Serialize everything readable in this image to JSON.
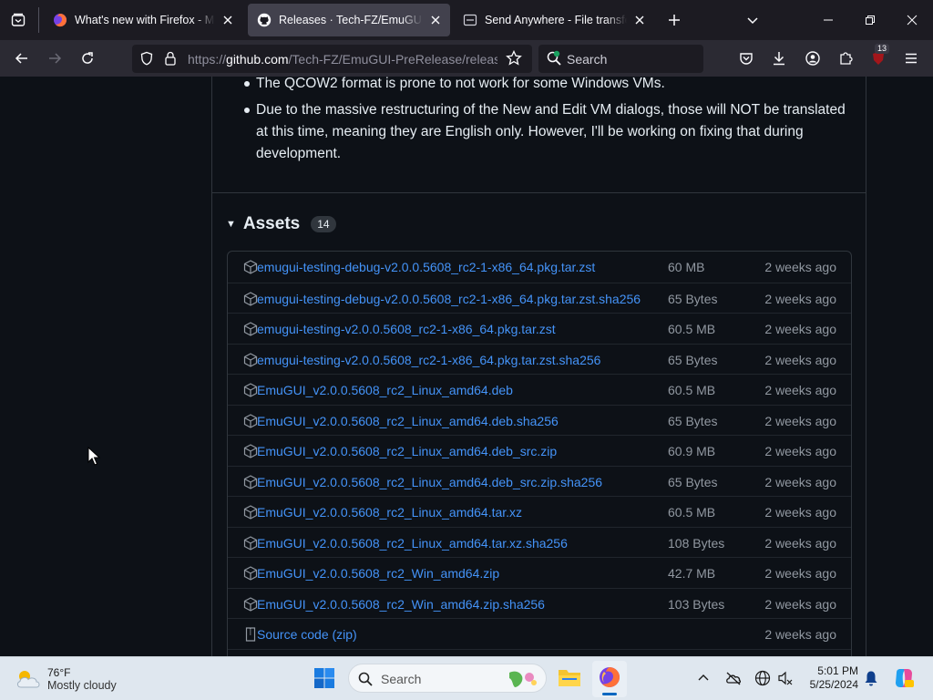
{
  "browser": {
    "tabs": [
      {
        "title": "What's new with Firefox - More",
        "icon": "firefox-icon",
        "active": false
      },
      {
        "title": "Releases · Tech-FZ/EmuGUI-PreRelease",
        "icon": "github-icon",
        "active": true
      },
      {
        "title": "Send Anywhere - File transfer",
        "icon": "send-anywhere-icon",
        "active": false
      }
    ],
    "url": {
      "scheme": "https://",
      "host": "github.com",
      "path": "/Tech-FZ/EmuGUI-PreRelease/releases"
    },
    "search_placeholder": "Search",
    "extension_badge": "13"
  },
  "release": {
    "notes": [
      "The QCOW2 format is prone to not work for some Windows VMs.",
      "Due to the massive restructuring of the New and Edit VM dialogs, those will NOT be translated at this time, meaning they are English only. However, I'll be working on fixing that during development."
    ],
    "assets_title": "Assets",
    "assets_count": "14",
    "assets": [
      {
        "name": "emugui-testing-debug-v2.0.0.5608_rc2-1-x86_64.pkg.tar.zst",
        "size": "60 MB",
        "date": "2 weeks ago"
      },
      {
        "name": "emugui-testing-debug-v2.0.0.5608_rc2-1-x86_64.pkg.tar.zst.sha256",
        "size": "65 Bytes",
        "date": "2 weeks ago"
      },
      {
        "name": "emugui-testing-v2.0.0.5608_rc2-1-x86_64.pkg.tar.zst",
        "size": "60.5 MB",
        "date": "2 weeks ago"
      },
      {
        "name": "emugui-testing-v2.0.0.5608_rc2-1-x86_64.pkg.tar.zst.sha256",
        "size": "65 Bytes",
        "date": "2 weeks ago"
      },
      {
        "name": "EmuGUI_v2.0.0.5608_rc2_Linux_amd64.deb",
        "size": "60.5 MB",
        "date": "2 weeks ago"
      },
      {
        "name": "EmuGUI_v2.0.0.5608_rc2_Linux_amd64.deb.sha256",
        "size": "65 Bytes",
        "date": "2 weeks ago"
      },
      {
        "name": "EmuGUI_v2.0.0.5608_rc2_Linux_amd64.deb_src.zip",
        "size": "60.9 MB",
        "date": "2 weeks ago"
      },
      {
        "name": "EmuGUI_v2.0.0.5608_rc2_Linux_amd64.deb_src.zip.sha256",
        "size": "65 Bytes",
        "date": "2 weeks ago"
      },
      {
        "name": "EmuGUI_v2.0.0.5608_rc2_Linux_amd64.tar.xz",
        "size": "60.5 MB",
        "date": "2 weeks ago"
      },
      {
        "name": "EmuGUI_v2.0.0.5608_rc2_Linux_amd64.tar.xz.sha256",
        "size": "108 Bytes",
        "date": "2 weeks ago"
      },
      {
        "name": "EmuGUI_v2.0.0.5608_rc2_Win_amd64.zip",
        "size": "42.7 MB",
        "date": "2 weeks ago"
      },
      {
        "name": "EmuGUI_v2.0.0.5608_rc2_Win_amd64.zip.sha256",
        "size": "103 Bytes",
        "date": "2 weeks ago"
      }
    ],
    "source_code": {
      "label": "Source code",
      "format": "(zip)",
      "date": "2 weeks ago"
    }
  },
  "taskbar": {
    "weather_temp": "76°F",
    "weather_cond": "Mostly cloudy",
    "search_label": "Search",
    "time": "5:01 PM",
    "date": "5/25/2024"
  },
  "colors": {
    "page_bg": "#0d1117",
    "link": "#4493f8",
    "muted": "#9198a1",
    "border": "#30363d"
  }
}
